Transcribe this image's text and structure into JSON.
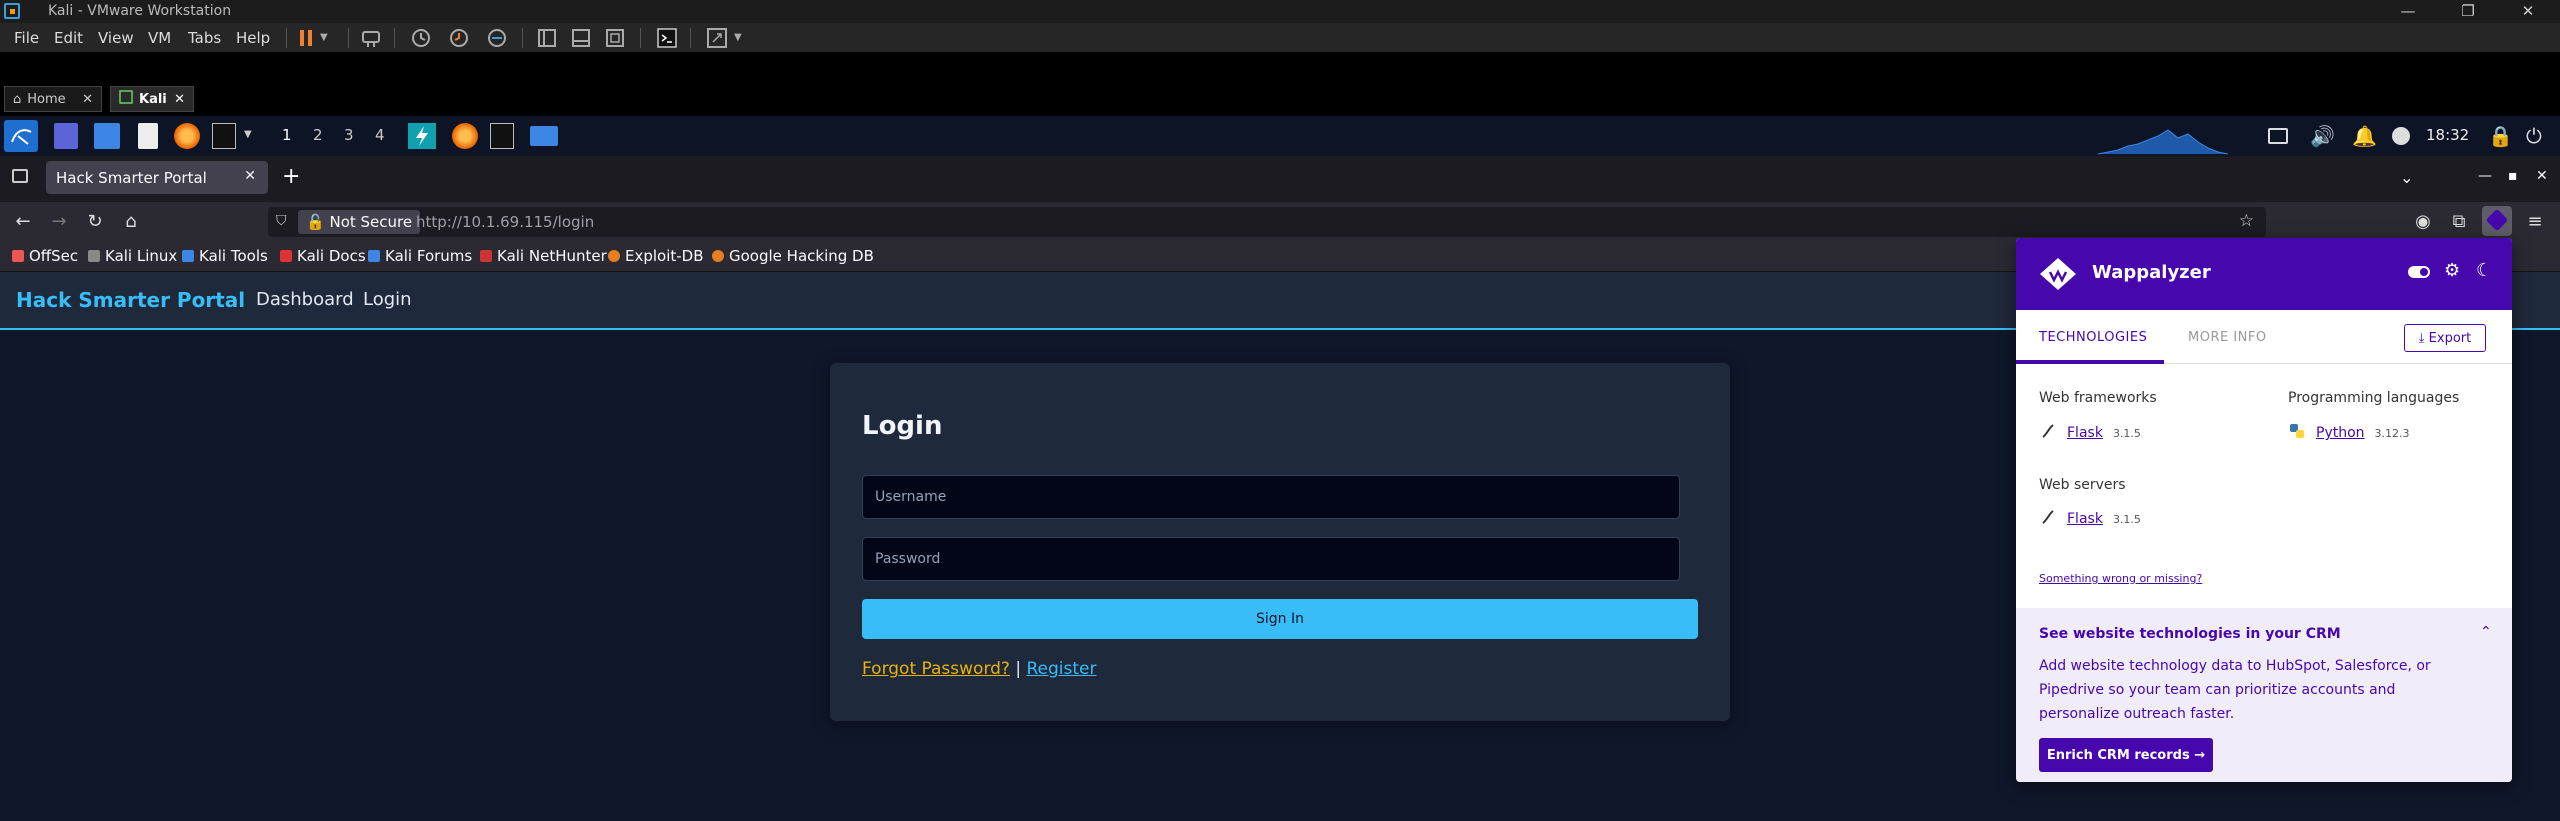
{
  "vmware": {
    "title": "Kali - VMware Workstation",
    "menus": [
      "File",
      "Edit",
      "View",
      "VM",
      "Tabs",
      "Help"
    ],
    "tabs": [
      {
        "label": "Home",
        "active": false
      },
      {
        "label": "Kali",
        "active": true
      }
    ]
  },
  "kali_panel": {
    "workspaces": [
      "1",
      "2",
      "3",
      "4"
    ],
    "clock": "18:32"
  },
  "firefox": {
    "tab_title": "Hack Smarter Portal",
    "security_label": "Not Secure",
    "url": "http://10.1.69.115/login",
    "bookmarks": [
      "OffSec",
      "Kali Linux",
      "Kali Tools",
      "Kali Docs",
      "Kali Forums",
      "Kali NetHunter",
      "Exploit-DB",
      "Google Hacking DB"
    ]
  },
  "site": {
    "brand": "Hack Smarter Portal",
    "nav": [
      "Dashboard",
      "Login"
    ],
    "login": {
      "title": "Login",
      "username_placeholder": "Username",
      "password_placeholder": "Password",
      "signin_label": "Sign In",
      "forgot_label": "Forgot Password?",
      "separator": "|",
      "register_label": "Register"
    }
  },
  "wappalyzer": {
    "name": "Wappalyzer",
    "tabs": {
      "technologies": "TECHNOLOGIES",
      "more_info": "MORE INFO"
    },
    "export_label": "Export",
    "categories": [
      {
        "name": "Web frameworks",
        "items": [
          {
            "name": "Flask",
            "version": "3.1.5"
          }
        ]
      },
      {
        "name": "Programming languages",
        "items": [
          {
            "name": "Python",
            "version": "3.12.3"
          }
        ]
      },
      {
        "name": "Web servers",
        "items": [
          {
            "name": "Flask",
            "version": "3.1.5"
          }
        ]
      }
    ],
    "wrong_link": "Something wrong or missing?",
    "crm": {
      "heading": "See website technologies in your CRM",
      "body": "Add website technology data to HubSpot, Salesforce, or Pipedrive so your team can prioritize accounts and personalize outreach faster.",
      "button": "Enrich CRM records"
    }
  },
  "colors": {
    "accent": "#38bdf8",
    "wappalyzer_brand": "#4608ad",
    "page_bg": "#0f172a",
    "card_bg": "#1e293b",
    "forgot_link": "#eab308"
  }
}
